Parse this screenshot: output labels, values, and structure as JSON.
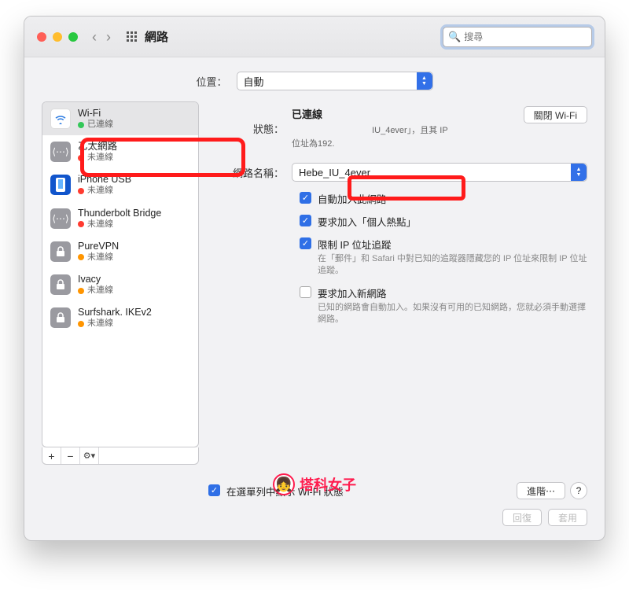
{
  "titlebar": {
    "title": "網路"
  },
  "search": {
    "placeholder": "搜尋"
  },
  "location": {
    "label": "位置：",
    "value": "自動"
  },
  "sidebar": {
    "items": [
      {
        "name": "Wi-Fi",
        "status": "已連線",
        "dot": "green",
        "icon": "wifi"
      },
      {
        "name": "乙太網路",
        "status": "未連線",
        "dot": "red",
        "icon": "eth"
      },
      {
        "name": "iPhone USB",
        "status": "未連線",
        "dot": "red",
        "icon": "phone"
      },
      {
        "name": "Thunderbolt Bridge",
        "status": "未連線",
        "dot": "red",
        "icon": "eth"
      },
      {
        "name": "PureVPN",
        "status": "未連線",
        "dot": "orange",
        "icon": "lock"
      },
      {
        "name": "Ivacy",
        "status": "未連線",
        "dot": "orange",
        "icon": "lock"
      },
      {
        "name": "Surfshark. IKEv2",
        "status": "未連線",
        "dot": "orange",
        "icon": "lock"
      }
    ]
  },
  "main": {
    "status_label": "狀態：",
    "status_value": "已連線",
    "turnoff_btn": "關閉 Wi-Fi",
    "status_desc_suffix": "IU_4ever」，且其 IP",
    "ip_line": "位址為192.",
    "network_label": "網路名稱：",
    "network_value": "Hebe_IU_4ever",
    "chk_autojoin": "自動加入此網路",
    "chk_hotspot": "要求加入「個人熱點」",
    "chk_limitip": "限制 IP 位址追蹤",
    "chk_limitip_desc": "在「郵件」和 Safari 中對已知的追蹤器隱藏您的 IP 位址來限制 IP 位址追蹤。",
    "chk_asknew": "要求加入新網路",
    "chk_asknew_desc": "已知的網路會自動加入。如果沒有可用的已知網路，您就必須手動選擇網路。"
  },
  "bottom": {
    "menubar_chk": "在選單列中顯示 Wi-Fi 狀態",
    "advanced_btn": "進階⋯",
    "revert_btn": "回復",
    "apply_btn": "套用"
  },
  "watermark": "塔科女子"
}
